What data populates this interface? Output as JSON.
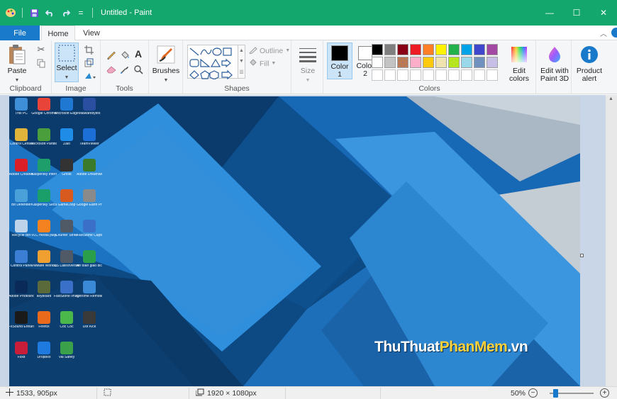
{
  "window": {
    "title": "Untitled - Paint",
    "controls": {
      "minimize": "—",
      "maximize": "☐",
      "close": "✕"
    }
  },
  "quick_access": {
    "separator_label": "="
  },
  "tabs": [
    {
      "label": "File"
    },
    {
      "label": "Home"
    },
    {
      "label": "View"
    }
  ],
  "ribbon": {
    "clipboard": {
      "group_label": "Clipboard",
      "paste_label": "Paste"
    },
    "image": {
      "group_label": "Image",
      "select_label": "Select"
    },
    "tools": {
      "group_label": "Tools"
    },
    "brushes": {
      "label": "Brushes"
    },
    "shapes": {
      "group_label": "Shapes",
      "outline_label": "Outline",
      "fill_label": "Fill"
    },
    "size": {
      "label": "Size"
    },
    "colors": {
      "group_label": "Colors",
      "color1_label": "Color\n1",
      "color2_label": "Color\n2",
      "color1": "#000000",
      "color2": "#ffffff",
      "edit_colors_label": "Edit\ncolors",
      "palette_row1": [
        "#000000",
        "#7f7f7f",
        "#880015",
        "#ed1c24",
        "#ff7f27",
        "#fff200",
        "#22b14c",
        "#00a2e8",
        "#3f48cc",
        "#a349a4"
      ],
      "palette_row2": [
        "#ffffff",
        "#c3c3c3",
        "#b97a57",
        "#ffaec9",
        "#ffc90e",
        "#efe4b0",
        "#b5e61d",
        "#99d9ea",
        "#7092be",
        "#c8bfe7"
      ]
    },
    "paint3d": {
      "label": "Edit with\nPaint 3D"
    },
    "product_alert": {
      "label": "Product\nalert"
    }
  },
  "canvas": {
    "desktop_icons": [
      {
        "label": "This PC",
        "color": "#3f8fd8"
      },
      {
        "label": "Google Chrome",
        "color": "#e8443a"
      },
      {
        "label": "Microsoft Edge",
        "color": "#1f78d1"
      },
      {
        "label": "Malwarebytes",
        "color": "#2a4ea0"
      },
      {
        "label": "Control Center",
        "color": "#e0b33a"
      },
      {
        "label": "Microsoft Partition",
        "color": "#4b9e3c"
      },
      {
        "label": "Zalo",
        "color": "#1f8de8"
      },
      {
        "label": "TeamViewer",
        "color": "#1d6fd8"
      },
      {
        "label": "Adobe Creative",
        "color": "#da1f26"
      },
      {
        "label": "Kaspersky Internet",
        "color": "#1e9e6a"
      },
      {
        "label": "Ghost",
        "color": "#333333"
      },
      {
        "label": "Adobe Dreamweaver",
        "color": "#3a7a2a"
      },
      {
        "label": "Bit Defender",
        "color": "#4aa0d8"
      },
      {
        "label": "Kaspersky Secure Co.",
        "color": "#1a9e6a"
      },
      {
        "label": "GameLoop",
        "color": "#d85a1e"
      },
      {
        "label": "Google Earth Pro",
        "color": "#8a8a8a"
      },
      {
        "label": "Recycle Bin",
        "color": "#bcd3ea"
      },
      {
        "label": "VLC media player",
        "color": "#f58220"
      },
      {
        "label": "Counter Strike",
        "color": "#505a66"
      },
      {
        "label": "FastStone Capture",
        "color": "#3a70c8"
      },
      {
        "label": "Control Panel",
        "color": "#3b7ed3"
      },
      {
        "label": "VMware Workstation",
        "color": "#f0a030"
      },
      {
        "label": "CS LatestVersion",
        "color": "#505a66"
      },
      {
        "label": "An toan giao dich",
        "color": "#2a9e4a"
      },
      {
        "label": "Adobe Photoshop",
        "color": "#0a2a5a"
      },
      {
        "label": "keyboard",
        "color": "#5a6a3a"
      },
      {
        "label": "FastStone Image Viewer",
        "color": "#3a70c8"
      },
      {
        "label": "Chrome Remote Desktop",
        "color": "#3a8ad8"
      },
      {
        "label": "FxSound Enhancer",
        "color": "#1a1a1a"
      },
      {
        "label": "Firefox",
        "color": "#e86a1a"
      },
      {
        "label": "Coc Coc",
        "color": "#4ab84a"
      },
      {
        "label": "Dot Kick",
        "color": "#3a3a3a"
      },
      {
        "label": "Foxit",
        "color": "#c81e3a"
      },
      {
        "label": "Dropbox",
        "color": "#1f7ae0"
      },
      {
        "label": "Vai Safety",
        "color": "#3aa04a"
      }
    ],
    "watermark_a": "ThuThuat",
    "watermark_b": "PhanMem",
    "watermark_c": ".vn"
  },
  "status": {
    "cursor_pos": "1533, 905px",
    "selection_size": "",
    "image_size": "1920 × 1080px",
    "zoom": "50%"
  }
}
